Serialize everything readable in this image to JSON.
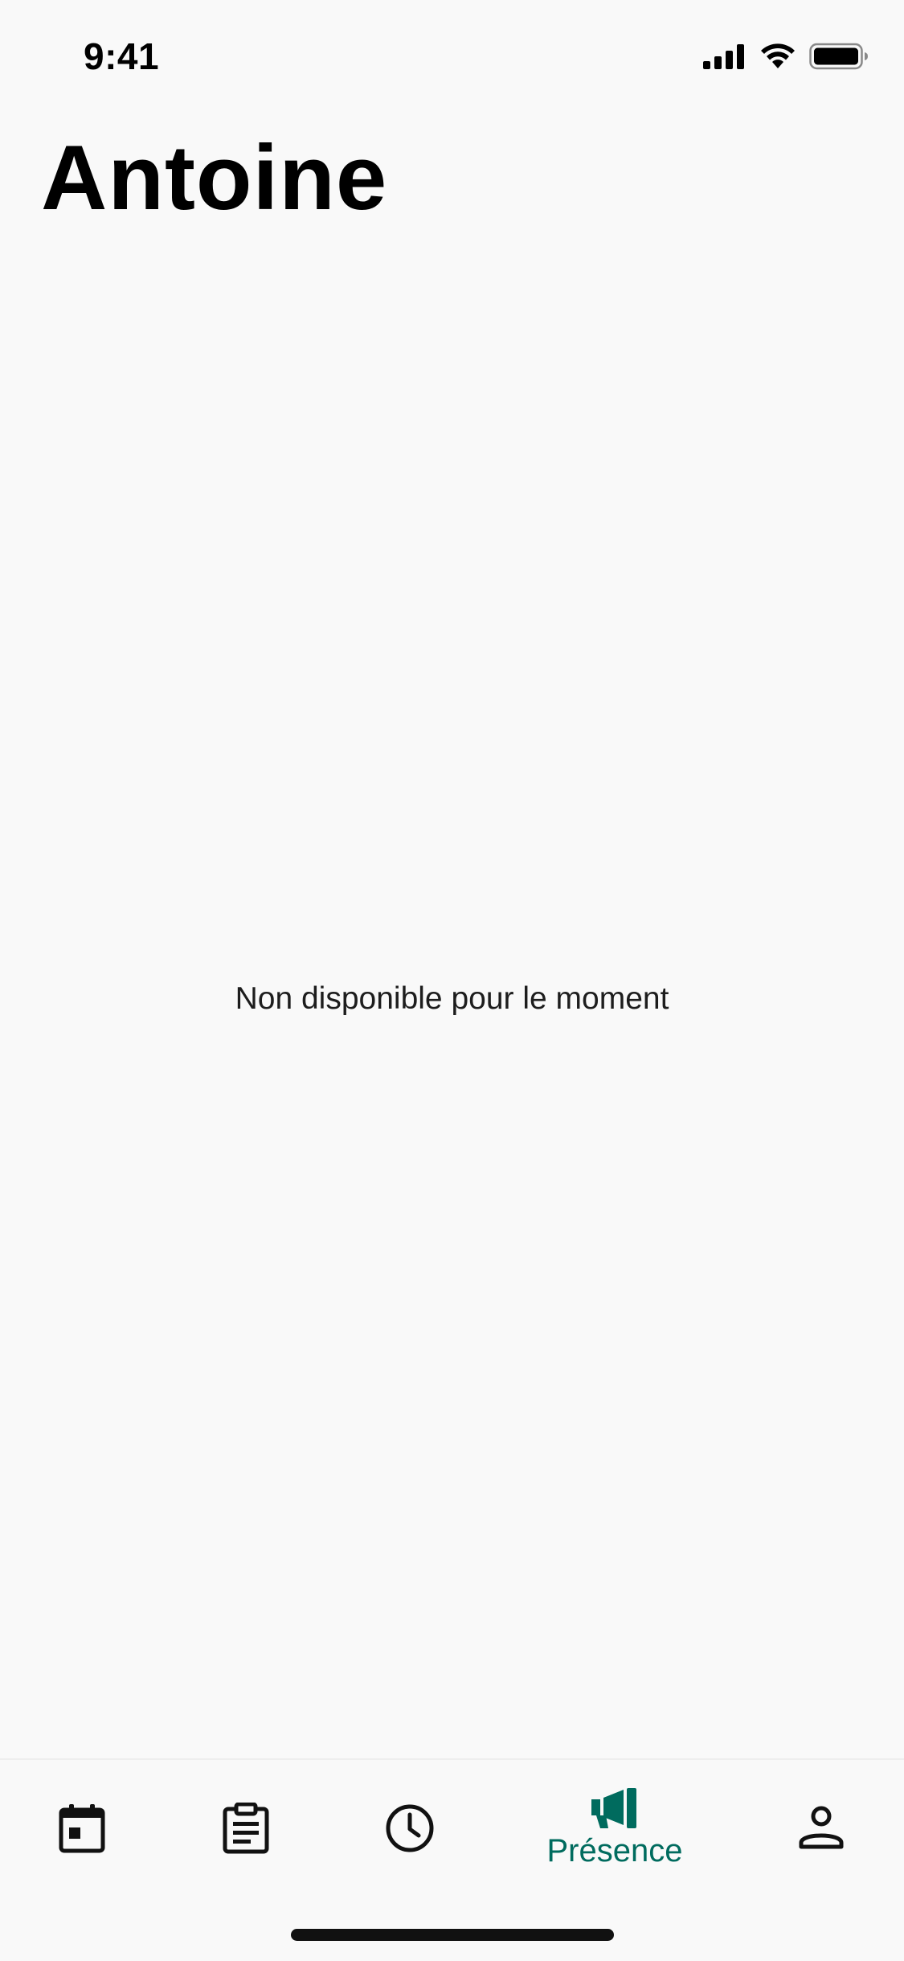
{
  "status_bar": {
    "time": "9:41",
    "icons": [
      "cellular-signal-icon",
      "wifi-icon",
      "battery-icon"
    ]
  },
  "page": {
    "title": "Antoine",
    "empty_message": "Non disponible pour le moment"
  },
  "tab_bar": {
    "accent_color": "#006b5e",
    "tabs": [
      {
        "icon": "calendar-icon",
        "label": "",
        "active": false
      },
      {
        "icon": "clipboard-icon",
        "label": "",
        "active": false
      },
      {
        "icon": "clock-icon",
        "label": "",
        "active": false
      },
      {
        "icon": "megaphone-icon",
        "label": "Présence",
        "active": true
      },
      {
        "icon": "person-icon",
        "label": "",
        "active": false
      }
    ]
  }
}
